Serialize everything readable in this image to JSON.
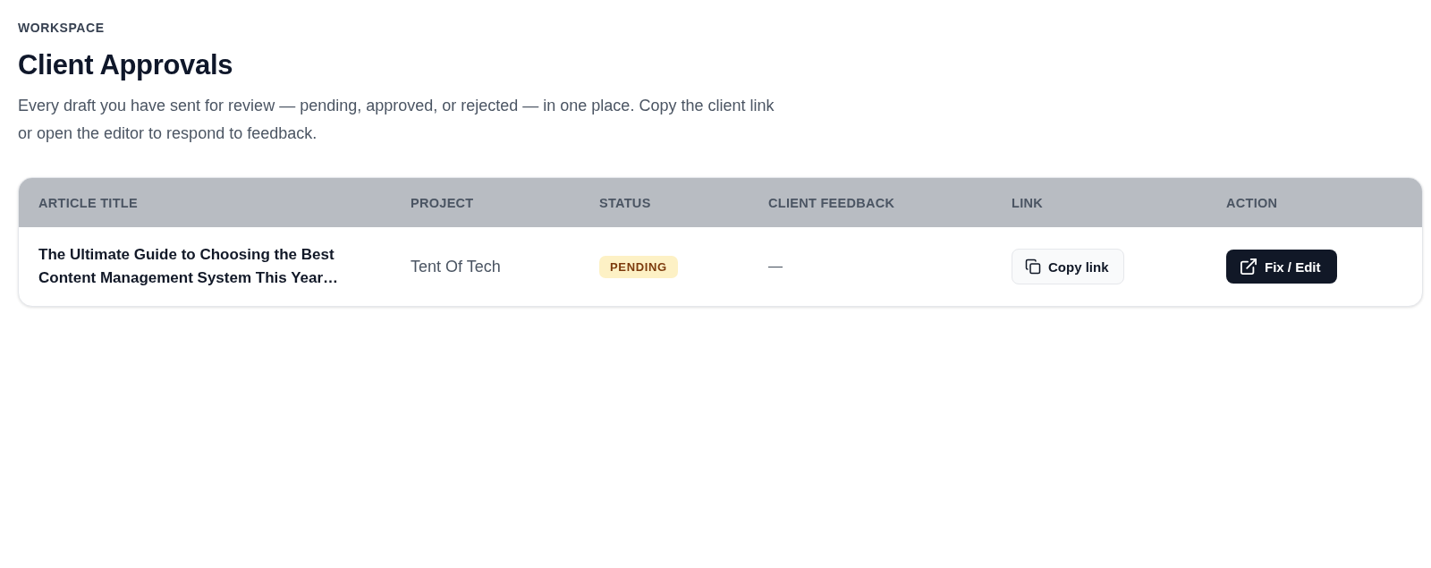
{
  "header": {
    "eyebrow": "WORKSPACE",
    "title": "Client Approvals",
    "description": "Every draft you have sent for review — pending, approved, or rejected — in one place. Copy the client link or open the editor to respond to feedback."
  },
  "table": {
    "columns": [
      "ARTICLE TITLE",
      "PROJECT",
      "STATUS",
      "CLIENT FEEDBACK",
      "LINK",
      "ACTION"
    ],
    "rows": [
      {
        "title": "The Ultimate Guide to Choosing the Best Content Management System This Year…",
        "project": "Tent Of Tech",
        "status": {
          "label": "PENDING",
          "kind": "pending"
        },
        "feedback": "—",
        "link_button": "Copy link",
        "action_button": "Fix / Edit"
      }
    ]
  }
}
